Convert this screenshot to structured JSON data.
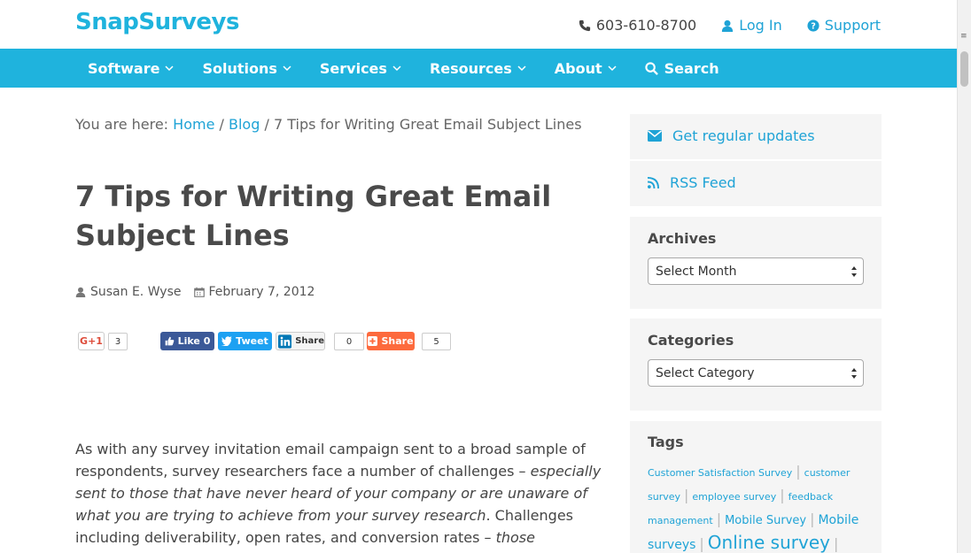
{
  "header": {
    "logo_part1": "Snap",
    "logo_part2": "Surveys",
    "phone": "603-610-8700",
    "login": "Log In",
    "support": "Support"
  },
  "nav": {
    "items": [
      {
        "label": "Software"
      },
      {
        "label": "Solutions"
      },
      {
        "label": "Services"
      },
      {
        "label": "Resources"
      },
      {
        "label": "About"
      }
    ],
    "search": "Search"
  },
  "breadcrumb": {
    "prefix": "You are here:",
    "home": "Home",
    "sep1": "/",
    "blog": "Blog",
    "sep2": "/",
    "current": "7 Tips for Writing Great Email Subject Lines"
  },
  "article": {
    "title": "7 Tips for Writing Great Email Subject Lines",
    "author": "Susan E. Wyse",
    "date": "February 7, 2012",
    "body_p1_a": "As with any survey invitation email campaign sent to a broad sample of respondents, survey researchers face a number of challenges – ",
    "body_p1_em1": "especially sent to those that have never heard of your company or are unaware of what you are trying to achieve from your survey research",
    "body_p1_b": ". Challenges including deliverability, open rates, and conversion rates – ",
    "body_p1_em2": "those conversions being the successful completion of"
  },
  "social": {
    "gplus_label": "G+1",
    "gplus_count": "3",
    "fb_label": "Like 0",
    "tw_label": "Tweet",
    "li_label": "Share",
    "li_count": "0",
    "share_label": "Share",
    "share_count": "5"
  },
  "sidebar": {
    "updates": "Get regular updates",
    "rss": "RSS Feed",
    "archives_heading": "Archives",
    "archives_select": "Select Month",
    "categories_heading": "Categories",
    "categories_select": "Select Category",
    "tags_heading": "Tags",
    "tags": [
      {
        "label": "Customer Satisfaction Survey"
      },
      {
        "label": "customer survey"
      },
      {
        "label": "employee survey"
      },
      {
        "label": "feedback management"
      },
      {
        "label": "Mobile Survey"
      },
      {
        "label": "Mobile surveys"
      },
      {
        "label": "Online survey"
      }
    ]
  },
  "colors": {
    "brand": "#1fb3dd",
    "link": "#1fa3d6",
    "facebook": "#3b5998",
    "twitter": "#1da1f2",
    "linkedin": "#0077b5",
    "share_orange": "#fd6a3d"
  }
}
